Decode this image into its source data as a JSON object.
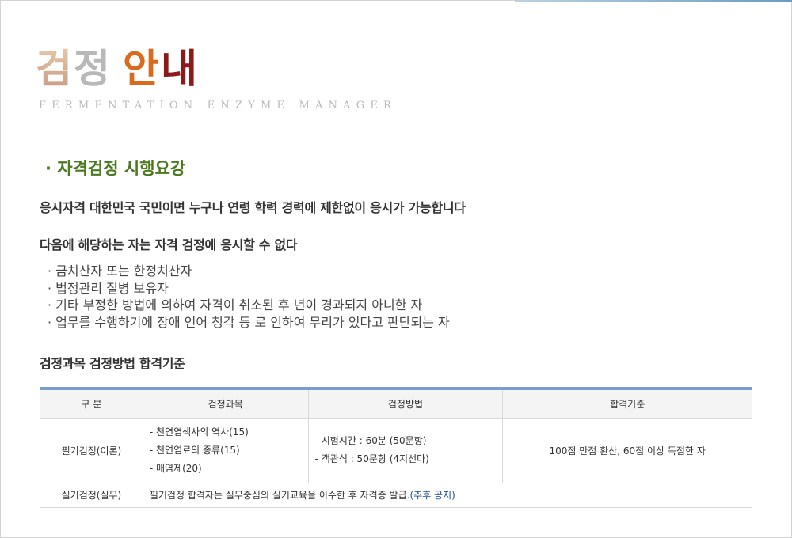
{
  "hero": {
    "title_part1": "검",
    "title_part2": "정",
    "title_part3": "안",
    "title_part4": "내",
    "subtitle": "FERMENTATION ENZYME MANAGER"
  },
  "section": {
    "heading": "· 자격검정 시행요강"
  },
  "body": {
    "eligibility": "응시자격 대한민국 국민이면 누구나 연령  학력 경력에 제한없이 응시가 가능합니다",
    "disqualify_intro": "다음에 해당하는 자는 자격 검정에 응시할 수 없다",
    "disqualify_items": [
      "· 금치산자 또는 한정치산자",
      "· 법정관리 질병 보유자",
      "· 기타 부정한 방법에 의하여 자격이 취소된 후    년이 경과되지 아니한 자",
      "· 업무를 수행하기에 장애 언어  청각 등  로 인하여 무리가 있다고 판단되는 자"
    ],
    "table_heading": "검정과목  검정방법  합격기준"
  },
  "table": {
    "headers": [
      "구 분",
      "검정과목",
      "검정방법",
      "합격기준"
    ],
    "written": {
      "label": "필기검정(이론)",
      "subjects": [
        "- 천연염색사의 역사(15)",
        "- 천연염료의 종류(15)",
        "- 매염제(20)"
      ],
      "methods": [
        "- 시험시간 : 60분 (50문항)",
        "- 객관식 : 50문항 (4지선다)"
      ],
      "criteria": "100점 만점 환산, 60점 이상 득점한 자"
    },
    "practical": {
      "label": "실기검정(실무)",
      "note": "필기검정 합격자는 실무중심의 실기교육을 이수한 후 자격증 발급.",
      "note_highlight": "(추후 공지)"
    }
  }
}
